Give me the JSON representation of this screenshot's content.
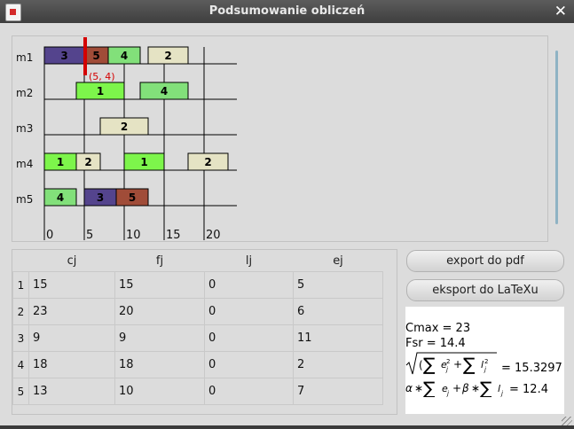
{
  "window": {
    "title": "Podsumowanie obliczeń"
  },
  "gantt": {
    "machines": [
      "m1",
      "m2",
      "m3",
      "m4",
      "m5"
    ],
    "x_ticks": [
      "0",
      "5",
      "10",
      "15",
      "20"
    ],
    "marker": {
      "label": "(5, 4)",
      "time": 5
    },
    "colors": {
      "1": "#7df54b",
      "2": "#e5e3c4",
      "3": "#54448d",
      "4": "#82e07a",
      "5": "#a04c38",
      "marker": "#d40000"
    },
    "tasks": [
      {
        "machine": 0,
        "job": "3",
        "start": 0,
        "end": 5
      },
      {
        "machine": 0,
        "job": "5",
        "start": 5,
        "end": 8
      },
      {
        "machine": 0,
        "job": "4",
        "start": 8,
        "end": 12
      },
      {
        "machine": 0,
        "job": "2",
        "start": 13,
        "end": 18
      },
      {
        "machine": 1,
        "job": "1",
        "start": 4,
        "end": 10
      },
      {
        "machine": 1,
        "job": "4",
        "start": 12,
        "end": 18
      },
      {
        "machine": 2,
        "job": "2",
        "start": 7,
        "end": 13
      },
      {
        "machine": 3,
        "job": "1",
        "start": 0,
        "end": 4
      },
      {
        "machine": 3,
        "job": "2",
        "start": 4,
        "end": 7
      },
      {
        "machine": 3,
        "job": "1",
        "start": 10,
        "end": 15
      },
      {
        "machine": 3,
        "job": "2",
        "start": 18,
        "end": 23
      },
      {
        "machine": 4,
        "job": "4",
        "start": 0,
        "end": 4
      },
      {
        "machine": 4,
        "job": "3",
        "start": 5,
        "end": 9
      },
      {
        "machine": 4,
        "job": "5",
        "start": 9,
        "end": 13
      }
    ]
  },
  "table": {
    "headers": [
      "cj",
      "fj",
      "lj",
      "ej"
    ],
    "rows": [
      {
        "n": "1",
        "cj": "15",
        "fj": "15",
        "lj": "0",
        "ej": "5"
      },
      {
        "n": "2",
        "cj": "23",
        "fj": "20",
        "lj": "0",
        "ej": "6"
      },
      {
        "n": "3",
        "cj": "9",
        "fj": "9",
        "lj": "0",
        "ej": "11"
      },
      {
        "n": "4",
        "cj": "18",
        "fj": "18",
        "lj": "0",
        "ej": "2"
      },
      {
        "n": "5",
        "cj": "13",
        "fj": "10",
        "lj": "0",
        "ej": "7"
      }
    ]
  },
  "buttons": {
    "export_pdf": "export do pdf",
    "export_latex": "eksport do LaTeXu"
  },
  "summary": {
    "cmax": "Cmax = 23",
    "fsr": "Fsr = 14.4",
    "sqrt_value": "= 15.3297",
    "weighted_value": "= 12.4"
  },
  "icons": {
    "app": "app-icon",
    "close": "close-icon",
    "resize": "resize-grip-icon"
  }
}
